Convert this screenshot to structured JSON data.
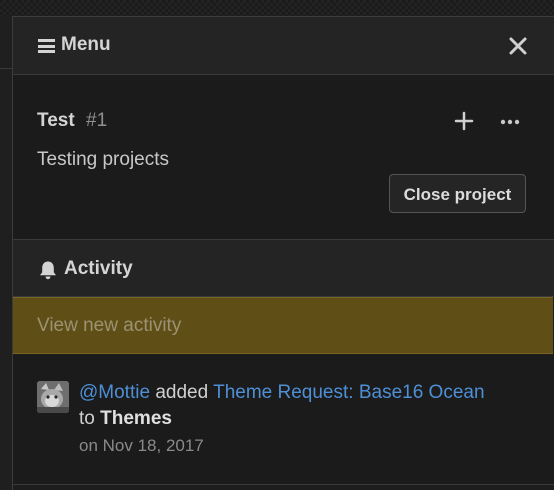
{
  "panel": {
    "title": "Menu"
  },
  "project": {
    "name": "Test",
    "number": "#1",
    "description": "Testing projects",
    "close_label": "Close project"
  },
  "activity": {
    "title": "Activity",
    "new_activity_label": "View new activity",
    "items": [
      {
        "user": "@Mottie",
        "verb": "added",
        "target": "Theme Request: Base16 Ocean",
        "preposition": "to",
        "column": "Themes",
        "date": "on Nov 18, 2017"
      }
    ]
  },
  "colors": {
    "accent_link": "#4e8fd6",
    "new_activity_bg": "#5f4f17",
    "panel_bg": "#1b1b1b",
    "header_bg": "#242424"
  },
  "icons": {
    "menu": "hamburger-icon",
    "close": "close-icon",
    "add": "plus-icon",
    "more": "ellipsis-icon",
    "activity": "bell-icon"
  }
}
